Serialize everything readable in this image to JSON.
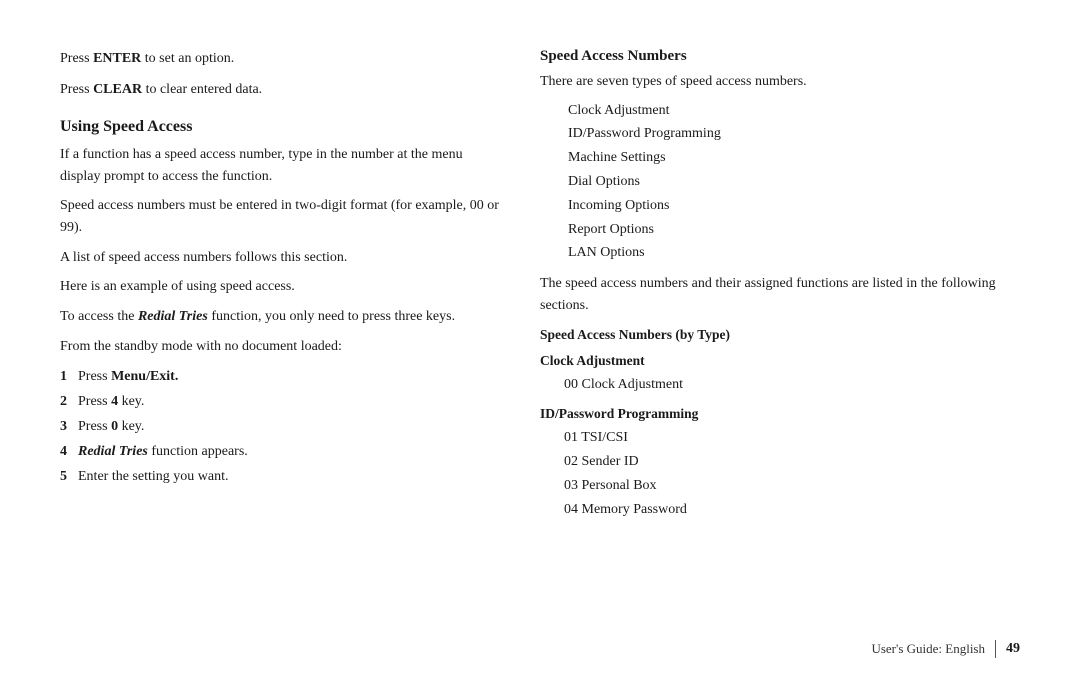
{
  "left": {
    "press_enter": "Press",
    "enter_word": "ENTER",
    "enter_rest": " to set an option.",
    "press_clear": "Press",
    "clear_word": "CLEAR",
    "clear_rest": " to clear entered data.",
    "section_heading": "Using  Speed  Access",
    "para1": "If a function has a speed access number, type in the number at the menu display prompt to access the function.",
    "para2": "Speed access numbers must be entered in two-digit format (for example, 00 or 99).",
    "para3": "A list of speed access numbers follows this section.",
    "para4": "Here is an example of using speed access.",
    "para5_pre": "To access the ",
    "para5_bold": "Redial Tries",
    "para5_post": " function, you only need to press three keys.",
    "para6": "From the standby mode with no document loaded:",
    "steps": [
      {
        "num": "1",
        "pre": "Press ",
        "bold": "Menu/Exit.",
        "post": ""
      },
      {
        "num": "2",
        "pre": "Press ",
        "bold": "4",
        "post": " key."
      },
      {
        "num": "3",
        "pre": "Press ",
        "bold": "0",
        "post": " key."
      },
      {
        "num": "4",
        "pre": "",
        "bold": "Redial Tries",
        "post": " function appears.",
        "italic_bold": true
      },
      {
        "num": "5",
        "pre": "Enter the setting you want.",
        "bold": "",
        "post": ""
      }
    ]
  },
  "right": {
    "speed_access_title": "Speed Access Numbers",
    "intro": "There are seven types of speed access numbers.",
    "types": [
      "Clock  Adjustment",
      "ID/Password Programming",
      "Machine  Settings",
      "Dial Options",
      "Incoming Options",
      "Report  Options",
      "LAN Options"
    ],
    "after_list": "The speed access numbers and their assigned functions are listed in the following sections.",
    "by_type_heading": "Speed Access Numbers (by Type)",
    "clock_heading": "Clock Adjustment",
    "clock_items": [
      "00 Clock Adjustment"
    ],
    "id_heading": "ID/Password Programming",
    "id_items": [
      "01 TSI/CSI",
      "02 Sender ID",
      "03 Personal Box",
      "04 Memory Password"
    ]
  },
  "footer": {
    "label": "User's Guide:  English",
    "page": "49"
  }
}
